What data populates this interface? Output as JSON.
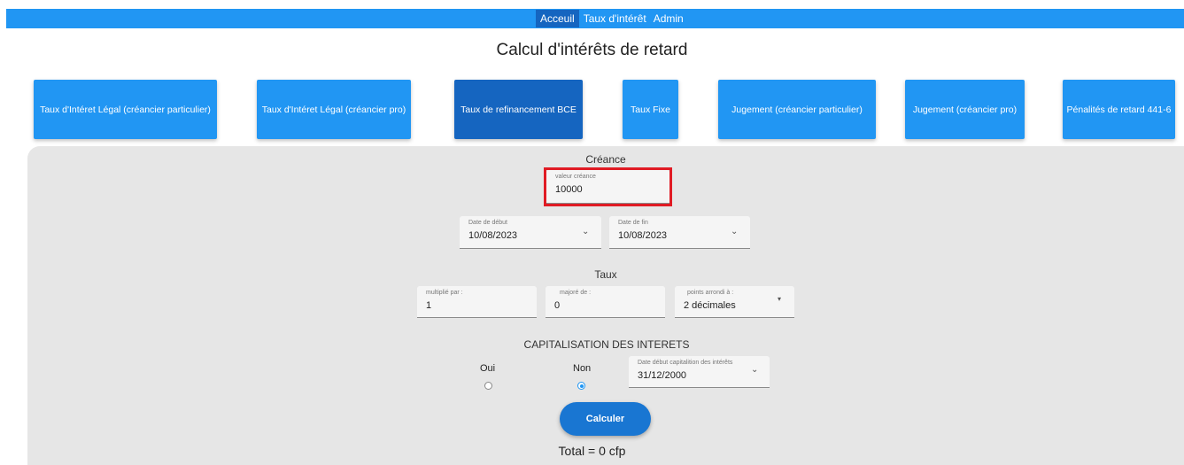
{
  "nav": {
    "items": [
      "Acceuil",
      "Taux d'intérêt",
      "Admin"
    ]
  },
  "page_title": "Calcul d'intérêts de retard",
  "modes": [
    "Taux d'Intéret Légal (créancier particulier)",
    "Taux d'Intéret Légal (créancier pro)",
    "Taux de refinancement BCE",
    "Taux Fixe",
    "Jugement (créancier particulier)",
    "Jugement (créancier pro)",
    "Pénalités de retard 441-6"
  ],
  "active_mode": "Taux de refinancement BCE",
  "creance": {
    "heading": "Créance",
    "label": "valeur créance",
    "value": "10000"
  },
  "dates": {
    "start_label": "Date de début",
    "start_value": "10/08/2023",
    "end_label": "Date de fin",
    "end_value": "10/08/2023"
  },
  "taux": {
    "heading": "Taux",
    "mult_label": "multiplié par :",
    "mult_value": "1",
    "majore_label": "majoré de :",
    "majore_value": "0",
    "arrondi_label": "points arrondi à :",
    "arrondi_value": "2 décimales"
  },
  "capitalisation": {
    "heading": "CAPITALISATION DES INTERETS",
    "oui_label": "Oui",
    "non_label": "Non",
    "selected": "Non",
    "date_label": "Date début capitalition des intérêts",
    "date_value": "31/12/2000"
  },
  "calculate_label": "Calculer",
  "total_text": "Total = 0 cfp",
  "colors": {
    "primary": "#2196f3",
    "primary_dark": "#1565c0",
    "panel": "#e6e6e6",
    "highlight": "#e01b24"
  }
}
